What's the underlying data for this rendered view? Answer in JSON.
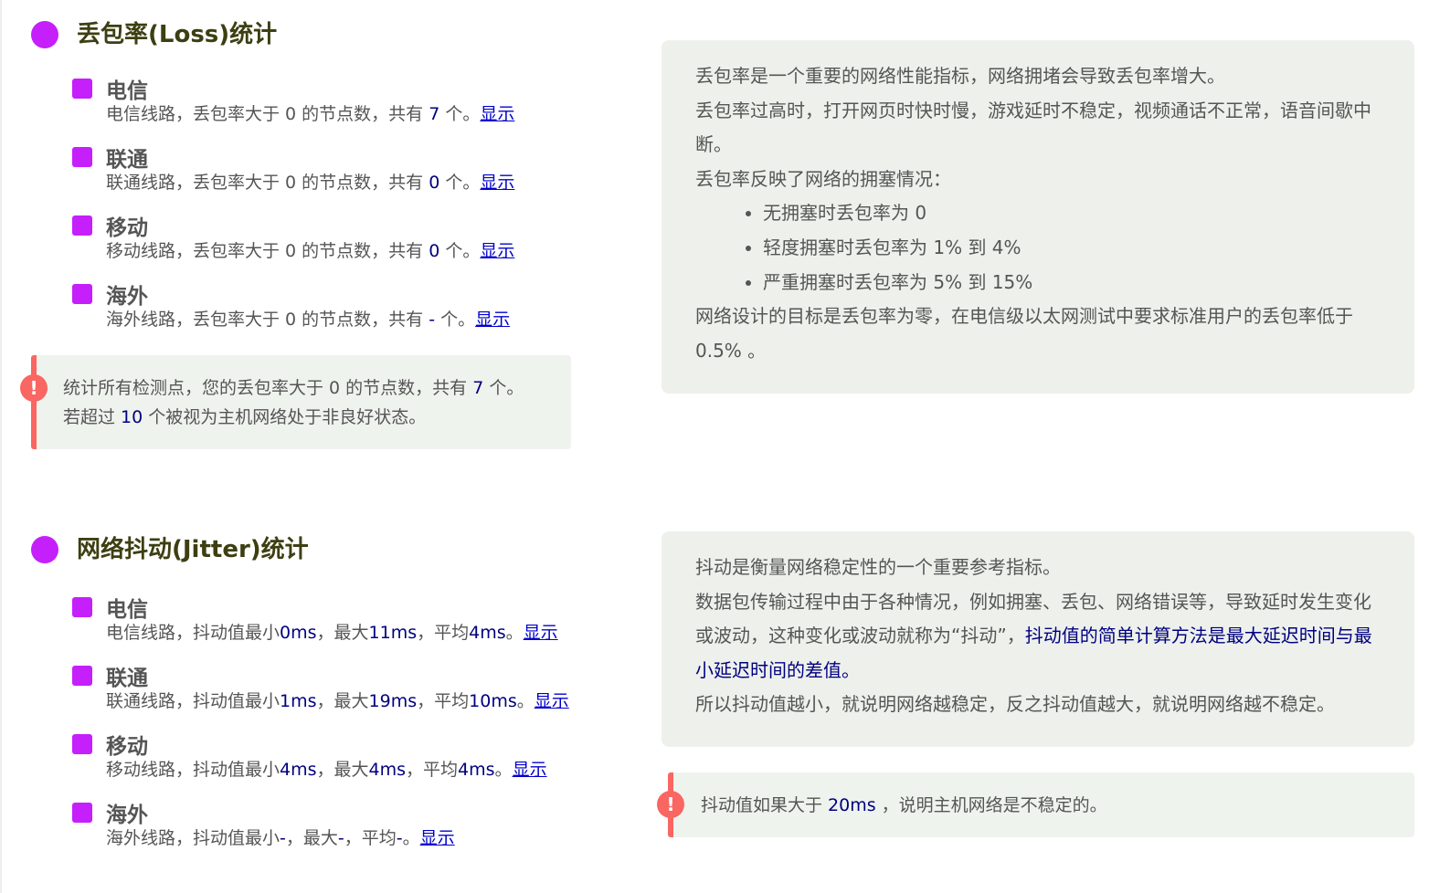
{
  "colors": {
    "accent_purple": "#c51ffc",
    "warn_red": "#fa6661",
    "title_dark": "#3d3f12",
    "panel_bg": "#eef1eb",
    "link_blue": "#0000cc",
    "value_navy": "#000080"
  },
  "loss": {
    "title": "丢包率(Loss)统计",
    "carriers": [
      {
        "name": "电信",
        "desc_pre": "电信线路，丢包率大于 0 的节点数，共有 ",
        "count": "7",
        "desc_post": " 个。",
        "link": "显示"
      },
      {
        "name": "联通",
        "desc_pre": "联通线路，丢包率大于 0 的节点数，共有 ",
        "count": "0",
        "desc_post": " 个。",
        "link": "显示"
      },
      {
        "name": "移动",
        "desc_pre": "移动线路，丢包率大于 0 的节点数，共有 ",
        "count": "0",
        "desc_post": " 个。",
        "link": "显示"
      },
      {
        "name": "海外",
        "desc_pre": "海外线路，丢包率大于 0 的节点数，共有 ",
        "count": "-",
        "desc_post": " 个。",
        "link": "显示"
      }
    ],
    "warning": {
      "icon": "exclamation-icon",
      "line1_pre": "统计所有检测点，您的丢包率大于 0 的节点数，共有 ",
      "line1_count": "7",
      "line1_post": " 个。",
      "line2_pre": "若超过 ",
      "line2_count": "10",
      "line2_post": " 个被视为主机网络处于非良好状态。"
    },
    "info": {
      "p1": "丢包率是一个重要的网络性能指标，网络拥堵会导致丢包率增大。",
      "p2": "丢包率过高时，打开网页时快时慢，游戏延时不稳定，视频通话不正常，语音间歇中断。",
      "p3": "丢包率反映了网络的拥塞情况：",
      "bullets": [
        "无拥塞时丢包率为 0",
        "轻度拥塞时丢包率为 1% 到 4%",
        "严重拥塞时丢包率为 5% 到 15%"
      ],
      "p4": "网络设计的目标是丢包率为零，在电信级以太网测试中要求标准用户的丢包率低于 0.5% 。"
    }
  },
  "jitter": {
    "title": "网络抖动(Jitter)统计",
    "carriers": [
      {
        "name": "电信",
        "prefix": "电信线路，抖动值最小",
        "min": "0ms",
        "mid1": "，最大",
        "max": "11ms",
        "mid2": "，平均",
        "avg": "4ms",
        "suffix": "。",
        "link": "显示"
      },
      {
        "name": "联通",
        "prefix": "联通线路，抖动值最小",
        "min": "1ms",
        "mid1": "，最大",
        "max": "19ms",
        "mid2": "，平均",
        "avg": "10ms",
        "suffix": "。",
        "link": "显示"
      },
      {
        "name": "移动",
        "prefix": "移动线路，抖动值最小",
        "min": "4ms",
        "mid1": "，最大",
        "max": "4ms",
        "mid2": "，平均",
        "avg": "4ms",
        "suffix": "。",
        "link": "显示"
      },
      {
        "name": "海外",
        "prefix": "海外线路，抖动值最小",
        "min": "-",
        "mid1": "，最大",
        "max": "-",
        "mid2": "，平均",
        "avg": "-",
        "suffix": "。",
        "link": "显示"
      }
    ],
    "info": {
      "p1": "抖动是衡量网络稳定性的一个重要参考指标。",
      "p2_pre": "数据包传输过程中由于各种情况，例如拥塞、丢包、网络错误等，导致延时发生变化或波动，这种变化或波动就称为“抖动”，",
      "p2_emph": "抖动值的简单计算方法是最大延迟时间与最小延迟时间的差值。",
      "p3": "所以抖动值越小，就说明网络越稳定，反之抖动值越大，就说明网络越不稳定。"
    },
    "warning": {
      "icon": "exclamation-icon",
      "text_pre": "抖动值如果大于 ",
      "value": "20ms",
      "text_post": " ，说明主机网络是不稳定的。"
    }
  }
}
